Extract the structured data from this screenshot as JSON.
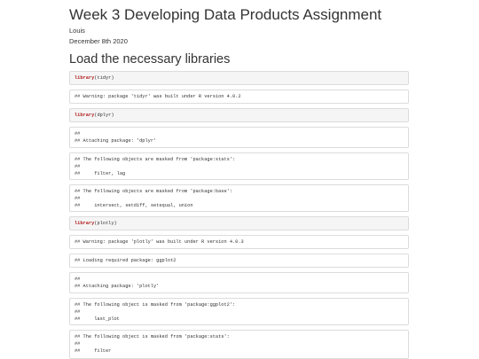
{
  "document": {
    "title": "Week 3 Developing Data Products Assignment",
    "author": "Louis",
    "date": "December 8th 2020",
    "section_heading": "Load the necessary libraries"
  },
  "blocks": [
    {
      "kind": "code",
      "fn": "library",
      "arg": "(tidyr)"
    },
    {
      "kind": "output",
      "lines": [
        "## Warning: package 'tidyr' was built under R version 4.0.2"
      ]
    },
    {
      "kind": "code",
      "fn": "library",
      "arg": "(dplyr)"
    },
    {
      "kind": "output",
      "lines": [
        "##",
        "## Attaching package: 'dplyr'"
      ]
    },
    {
      "kind": "output",
      "lines": [
        "## The following objects are masked from 'package:stats':",
        "##",
        "##     filter, lag"
      ]
    },
    {
      "kind": "output",
      "lines": [
        "## The following objects are masked from 'package:base':",
        "##",
        "##     intersect, setdiff, setequal, union"
      ]
    },
    {
      "kind": "code",
      "fn": "library",
      "arg": "(plotly)"
    },
    {
      "kind": "output",
      "lines": [
        "## Warning: package 'plotly' was built under R version 4.0.3"
      ]
    },
    {
      "kind": "output",
      "lines": [
        "## Loading required package: ggplot2"
      ]
    },
    {
      "kind": "output",
      "lines": [
        "##",
        "## Attaching package: 'plotly'"
      ]
    },
    {
      "kind": "output",
      "lines": [
        "## The following object is masked from 'package:ggplot2':",
        "##",
        "##     last_plot"
      ]
    },
    {
      "kind": "output",
      "lines": [
        "## The following object is masked from 'package:stats':",
        "##",
        "##     filter"
      ]
    }
  ]
}
